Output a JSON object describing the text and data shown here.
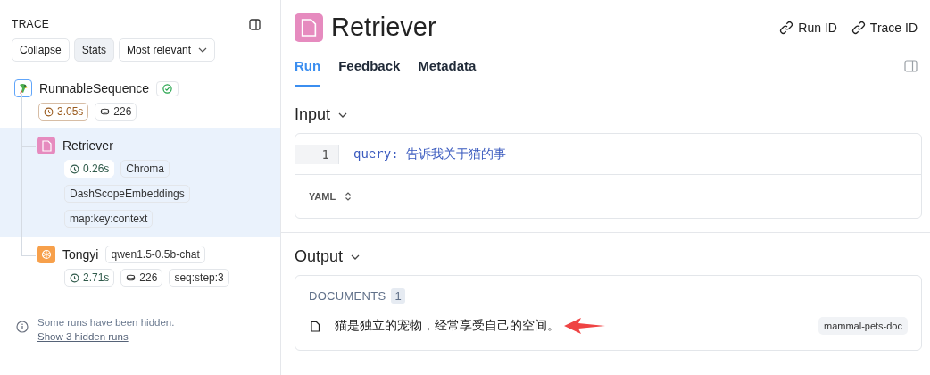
{
  "trace": {
    "title": "TRACE",
    "buttons": [
      {
        "label": "Collapse",
        "selected": false
      },
      {
        "label": "Stats",
        "selected": true
      }
    ],
    "sort": "Most relevant",
    "root": {
      "name": "RunnableSequence",
      "kind": "chain",
      "succeeded": true,
      "selected": false,
      "tags": [
        {
          "kind": "latency",
          "text": "3.05s",
          "color": "#9a5b1e"
        },
        {
          "kind": "tokens",
          "text": "226"
        }
      ],
      "children": [
        {
          "name": "Retriever",
          "kind": "retriever",
          "selected": true,
          "tags": [
            {
              "kind": "latency",
              "text": "0.26s",
              "color": "#2f5a4a"
            },
            {
              "kind": "label",
              "text": "Chroma"
            },
            {
              "kind": "label",
              "text": "DashScopeEmbeddings"
            },
            {
              "kind": "label",
              "text": "map:key:context"
            }
          ]
        },
        {
          "name": "Tongyi",
          "kind": "llm",
          "selected": false,
          "model": "qwen1.5-0.5b-chat",
          "tags": [
            {
              "kind": "latency",
              "text": "2.71s",
              "color": "#2f5a4a"
            },
            {
              "kind": "tokens",
              "text": "226"
            },
            {
              "kind": "label",
              "text": "seq:step:3"
            }
          ]
        }
      ]
    },
    "notice": "Some runs have been hidden.",
    "notice_link": "Show 3 hidden runs"
  },
  "run": {
    "kind": "retriever",
    "title": "Retriever",
    "links": [
      "Run ID",
      "Trace ID"
    ],
    "tabs": [
      {
        "label": "Run",
        "selected": true
      },
      {
        "label": "Feedback",
        "selected": false
      },
      {
        "label": "Metadata",
        "selected": false
      }
    ],
    "input": {
      "title": "Input",
      "expanded": true,
      "lines": [
        {
          "number": "1",
          "text": "query: 告诉我关于猫的事"
        }
      ],
      "format": "YAML"
    },
    "output": {
      "title": "Output",
      "expanded": true,
      "label": "DOCUMENTS",
      "count": "1",
      "documents": [
        {
          "text": "猫是独立的宠物，经常享受自己的空间。",
          "tag": "mammal-pets-doc",
          "annotated": true
        }
      ]
    }
  }
}
